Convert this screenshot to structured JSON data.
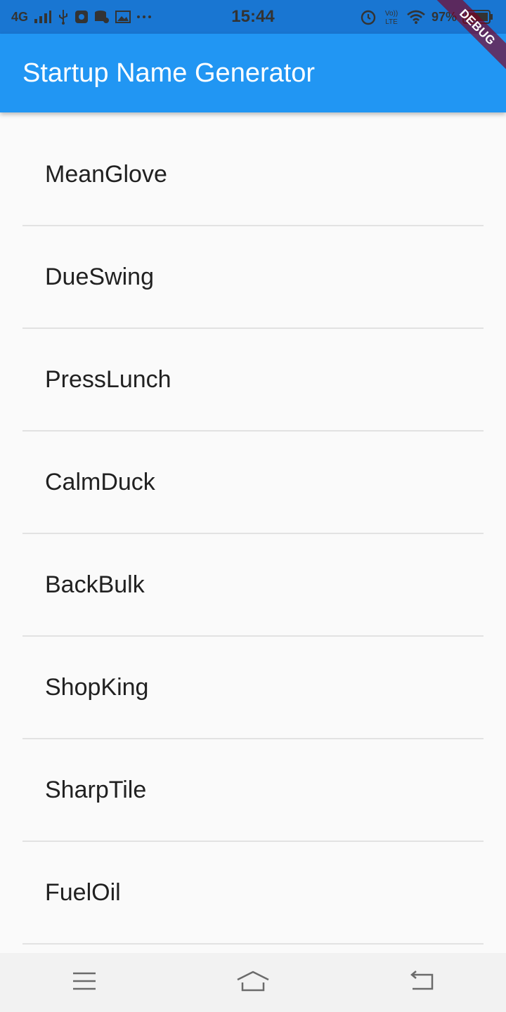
{
  "status_bar": {
    "network": "4G",
    "time": "15:44",
    "volte": "Vo)) LTE",
    "battery_percent": "97%"
  },
  "app_bar": {
    "title": "Startup Name Generator",
    "color": "#2196f3"
  },
  "debug_banner": {
    "label": "DEBUG"
  },
  "list": {
    "items": [
      {
        "label": "MeanGlove"
      },
      {
        "label": "DueSwing"
      },
      {
        "label": "PressLunch"
      },
      {
        "label": "CalmDuck"
      },
      {
        "label": "BackBulk"
      },
      {
        "label": "ShopKing"
      },
      {
        "label": "SharpTile"
      },
      {
        "label": "FuelOil"
      }
    ]
  },
  "nav_bar": {
    "buttons": [
      {
        "icon": "menu-icon"
      },
      {
        "icon": "home-icon"
      },
      {
        "icon": "back-icon"
      }
    ]
  }
}
